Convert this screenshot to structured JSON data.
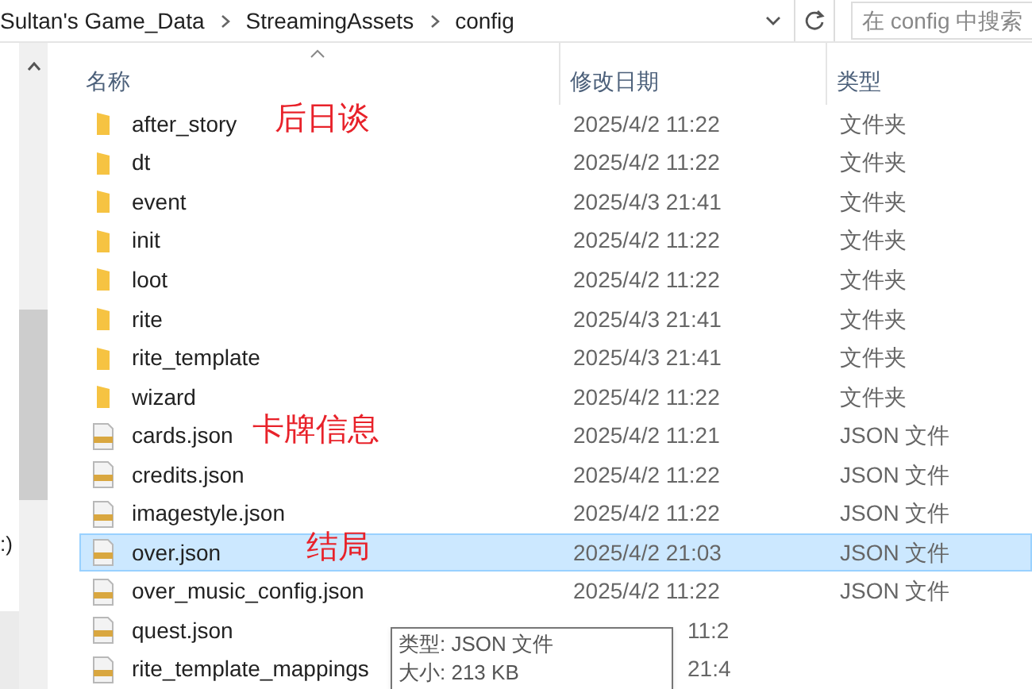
{
  "address_bar": {
    "crumbs": [
      "Sultan's Game_Data",
      "StreamingAssets",
      "config"
    ]
  },
  "search": {
    "placeholder": "在 config 中搜索"
  },
  "nav_pane": {
    "drive_label": ":)"
  },
  "columns": [
    {
      "label": "名称",
      "sorted": true
    },
    {
      "label": "修改日期",
      "sorted": false
    },
    {
      "label": "类型",
      "sorted": false
    }
  ],
  "rows": [
    {
      "kind": "folder",
      "name": "after_story",
      "date": "2025/4/2 11:22",
      "type": "文件夹",
      "note": "后日谈",
      "selected": false
    },
    {
      "kind": "folder",
      "name": "dt",
      "date": "2025/4/2 11:22",
      "type": "文件夹",
      "selected": false
    },
    {
      "kind": "folder",
      "name": "event",
      "date": "2025/4/3 21:41",
      "type": "文件夹",
      "selected": false
    },
    {
      "kind": "folder",
      "name": "init",
      "date": "2025/4/2 11:22",
      "type": "文件夹",
      "selected": false
    },
    {
      "kind": "folder",
      "name": "loot",
      "date": "2025/4/2 11:22",
      "type": "文件夹",
      "selected": false
    },
    {
      "kind": "folder",
      "name": "rite",
      "date": "2025/4/3 21:41",
      "type": "文件夹",
      "selected": false
    },
    {
      "kind": "folder",
      "name": "rite_template",
      "date": "2025/4/3 21:41",
      "type": "文件夹",
      "selected": false
    },
    {
      "kind": "folder",
      "name": "wizard",
      "date": "2025/4/2 11:22",
      "type": "文件夹",
      "selected": false
    },
    {
      "kind": "json",
      "name": "cards.json",
      "date": "2025/4/2 11:21",
      "type": "JSON 文件",
      "note": "卡牌信息",
      "selected": false
    },
    {
      "kind": "json",
      "name": "credits.json",
      "date": "2025/4/2 11:22",
      "type": "JSON 文件",
      "selected": false
    },
    {
      "kind": "json",
      "name": "imagestyle.json",
      "date": "2025/4/2 11:22",
      "type": "JSON 文件",
      "selected": false
    },
    {
      "kind": "json",
      "name": "over.json",
      "date": "2025/4/2 21:03",
      "type": "JSON 文件",
      "note": "结局",
      "selected": true
    },
    {
      "kind": "json",
      "name": "over_music_config.json",
      "date": "2025/4/2 11:22",
      "type": "JSON 文件",
      "selected": false
    },
    {
      "kind": "json",
      "name": "quest.json",
      "date": "11:2",
      "date_covered": true,
      "selected": false
    },
    {
      "kind": "json",
      "name": "rite_template_mappings",
      "date": "21:4",
      "date_covered": true,
      "selected": false
    }
  ],
  "tooltip": {
    "lines": [
      "类型: JSON 文件",
      "大小: 213 KB"
    ]
  }
}
